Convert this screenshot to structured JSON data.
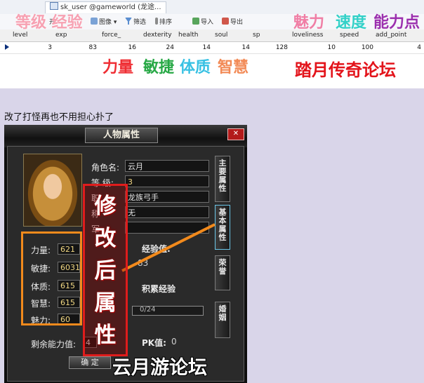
{
  "db": {
    "tab_title": "sk_user @gameworld (龙途...",
    "toolbar": {
      "open_label": "开",
      "image_label": "图像",
      "filter_label": "筛选",
      "sort_label": "排序",
      "import_label": "导入",
      "export_label": "导出"
    },
    "columns": [
      "level",
      "exp",
      "force_",
      "dexterity",
      "health",
      "soul",
      "sp",
      "loveliness",
      "speed",
      "add_point"
    ],
    "row": [
      "3",
      "83",
      "16",
      "24",
      "14",
      "14",
      "128",
      "10",
      "100",
      "4"
    ]
  },
  "overlay": {
    "level_exp": "等级 经验",
    "charm": "魅力",
    "speed": "速度",
    "ability_points": "能力点",
    "strength": "力量",
    "agility": "敏捷",
    "constitution": "体质",
    "wisdom": "智慧",
    "forum": "踏月传奇论坛",
    "watermark": "云月游论坛"
  },
  "caption": "改了打怪再也不用担心扑了",
  "game_window": {
    "title": "人物属性",
    "close_label": "✕",
    "role_name_label": "角色名:",
    "role_name_value": "云月",
    "level_label": "等   级:",
    "level_value": "3",
    "class_label": "职",
    "class_value": "龙族弓手",
    "faction_label": "称",
    "faction_value": "无",
    "army_label": "军",
    "army_value": "",
    "stats": [
      {
        "label": "力量:",
        "value": "621"
      },
      {
        "label": "敏捷:",
        "value": "6031"
      },
      {
        "label": "体质:",
        "value": "615"
      },
      {
        "label": "智慧:",
        "value": "615"
      },
      {
        "label": "魅力:",
        "value": "60"
      }
    ],
    "exp_label": "经验值:",
    "exp_value": "83",
    "accum_exp_label": "积累经验",
    "progress_text": "0/24",
    "pk_label": "PK值:",
    "pk_value": "0",
    "remaining_points_label": "剩余能力值:",
    "remaining_points_value": "4",
    "ok_label": "确    定",
    "side_tabs": [
      "主要属性",
      "基本属性",
      "荣誉",
      "婚姻"
    ],
    "modified_label": "修改后属性"
  },
  "colors": {
    "orange_box": "#f28a1c",
    "red_box": "#e01c1c",
    "forum_red": "#e3141b",
    "stat_value": "#f1d782"
  }
}
